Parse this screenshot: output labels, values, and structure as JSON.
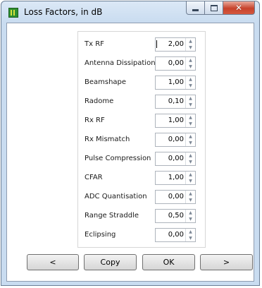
{
  "window": {
    "title": "Loss Factors, in dB"
  },
  "fields": [
    {
      "label": "Tx RF",
      "value": "2,00"
    },
    {
      "label": "Antenna Dissipation",
      "value": "0,00"
    },
    {
      "label": "Beamshape",
      "value": "1,00"
    },
    {
      "label": "Radome",
      "value": "0,10"
    },
    {
      "label": "Rx RF",
      "value": "1,00"
    },
    {
      "label": "Rx Mismatch",
      "value": "0,00"
    },
    {
      "label": "Pulse Compression",
      "value": "0,00"
    },
    {
      "label": "CFAR",
      "value": "1,00"
    },
    {
      "label": "ADC Quantisation",
      "value": "0,00"
    },
    {
      "label": "Range Straddle",
      "value": "0,50"
    },
    {
      "label": "Eclipsing",
      "value": "0,00"
    }
  ],
  "buttons": {
    "prev": "<",
    "copy": "Copy",
    "ok": "OK",
    "next": ">"
  },
  "icons": {
    "app": "app-icon",
    "spin_up": "▲",
    "spin_down": "▼"
  }
}
